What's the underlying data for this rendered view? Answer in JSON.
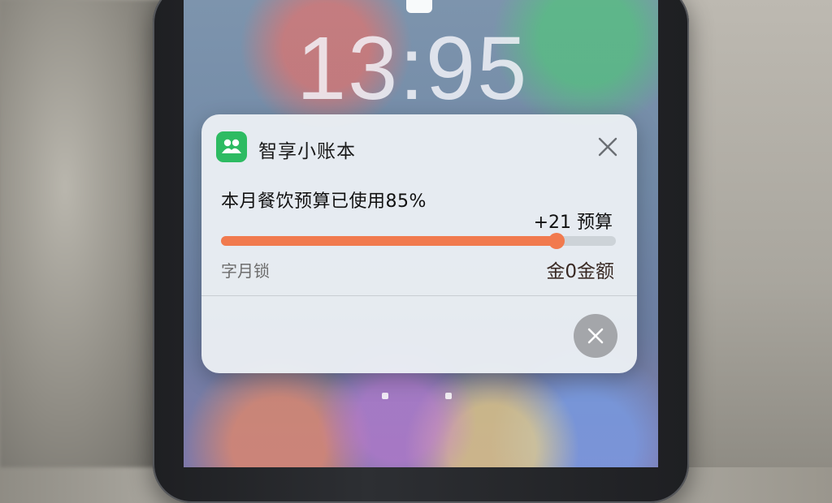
{
  "lock_screen": {
    "time": "13:95"
  },
  "notification": {
    "app_name": "智享小账本",
    "app_icon": "people-icon",
    "message": "本月餐饮预算已使用85%",
    "budget_delta": "+21 预算",
    "progress_percent": 85,
    "left_label": "字月锁",
    "right_label": "金0金额",
    "close_icon": "close-icon",
    "dismiss_icon": "close-icon"
  },
  "colors": {
    "accent": "#f17a4e",
    "app_icon_bg": "#2dbb62"
  }
}
